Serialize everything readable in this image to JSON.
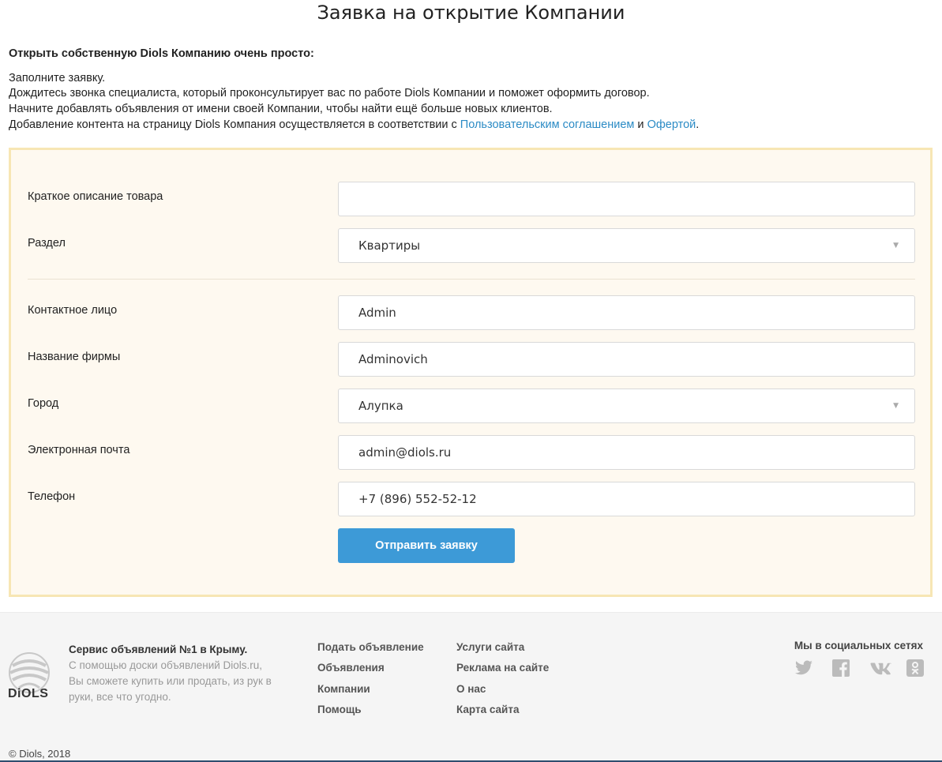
{
  "page": {
    "title": "Заявка на открытие Компании"
  },
  "intro": {
    "lead": "Открыть собственную Diols Компанию очень просто:",
    "line1": "Заполните заявку.",
    "line2": "Дождитесь звонка специалиста, который проконсультирует вас по работе Diols Компании и поможет оформить договор.",
    "line3": "Начните добавлять объявления от имени своей Компании, чтобы найти ещё больше новых клиентов.",
    "line4_prefix": "Добавление контента на страницу Diols Компания осуществляется в соответствии с ",
    "link_agreement": "Пользовательским соглашением",
    "line4_and": " и ",
    "link_offer": "Офертой",
    "line4_suffix": "."
  },
  "form": {
    "labels": {
      "description": "Краткое описание товара",
      "section": "Раздел",
      "contact": "Контактное лицо",
      "company": "Название фирмы",
      "city": "Город",
      "email": "Электронная почта",
      "phone": "Телефон"
    },
    "values": {
      "description": "",
      "section": "Квартиры",
      "contact": "Admin",
      "company": "Adminovich",
      "city": "Алупка",
      "email": "admin@diols.ru",
      "phone": "+7 (896) 552-52-12"
    },
    "submit_label": "Отправить заявку"
  },
  "footer": {
    "logo_text": "DiOLS",
    "about_title": "Сервис объявлений №1 в Крыму.",
    "about_text": "С помощью доски объявлений Diols.ru, Вы сможете купить или продать, из рук в руки, все что угодно.",
    "col1": [
      "Подать объявление",
      "Объявления",
      "Компании",
      "Помощь"
    ],
    "col2": [
      "Услуги сайта",
      "Реклама на сайте",
      "О нас",
      "Карта сайта"
    ],
    "social_title": "Мы в социальных сетях",
    "social_icons": [
      "twitter-icon",
      "facebook-icon",
      "vk-icon",
      "odnoklassniki-icon"
    ],
    "copyright": "© Diols, 2018"
  },
  "colors": {
    "link": "#2b8bc5",
    "button": "#3d9ad7",
    "form_bg": "#fef9f0",
    "form_border": "#f7e6b4"
  }
}
